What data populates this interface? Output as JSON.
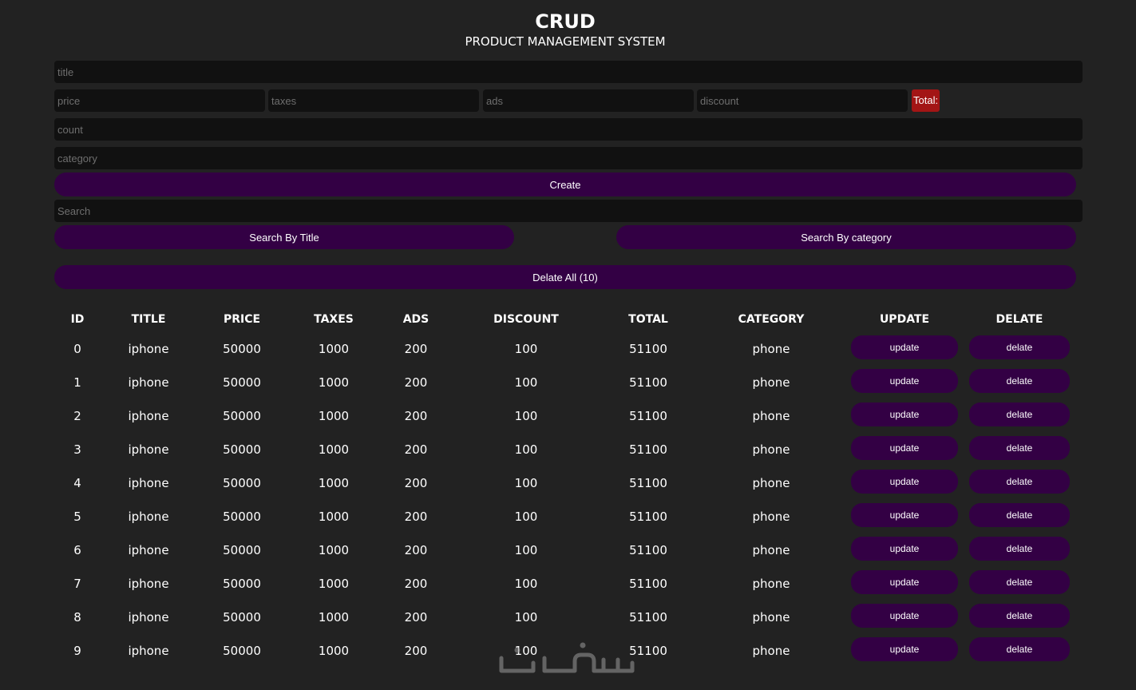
{
  "header": {
    "title": "CRUD",
    "subtitle": "PRODUCT MANAGEMENT SYSTEM"
  },
  "form": {
    "title_placeholder": "title",
    "price_placeholder": "price",
    "taxes_placeholder": "taxes",
    "ads_placeholder": "ads",
    "discount_placeholder": "discount",
    "total_label": "Total:",
    "count_placeholder": "count",
    "category_placeholder": "category",
    "create_label": "Create"
  },
  "search": {
    "placeholder": "Search",
    "by_title_label": "Search By Title",
    "by_category_label": "Search By category"
  },
  "delete_all_label": "Delate All (10)",
  "table": {
    "columns": [
      "ID",
      "TITLE",
      "PRICE",
      "TAXES",
      "ADS",
      "DISCOUNT",
      "TOTAL",
      "CATEGORY",
      "UPDATE",
      "DELATE"
    ],
    "update_label": "update",
    "delete_label": "delate",
    "rows": [
      {
        "id": "0",
        "title": "iphone",
        "price": "50000",
        "taxes": "1000",
        "ads": "200",
        "discount": "100",
        "total": "51100",
        "category": "phone"
      },
      {
        "id": "1",
        "title": "iphone",
        "price": "50000",
        "taxes": "1000",
        "ads": "200",
        "discount": "100",
        "total": "51100",
        "category": "phone"
      },
      {
        "id": "2",
        "title": "iphone",
        "price": "50000",
        "taxes": "1000",
        "ads": "200",
        "discount": "100",
        "total": "51100",
        "category": "phone"
      },
      {
        "id": "3",
        "title": "iphone",
        "price": "50000",
        "taxes": "1000",
        "ads": "200",
        "discount": "100",
        "total": "51100",
        "category": "phone"
      },
      {
        "id": "4",
        "title": "iphone",
        "price": "50000",
        "taxes": "1000",
        "ads": "200",
        "discount": "100",
        "total": "51100",
        "category": "phone"
      },
      {
        "id": "5",
        "title": "iphone",
        "price": "50000",
        "taxes": "1000",
        "ads": "200",
        "discount": "100",
        "total": "51100",
        "category": "phone"
      },
      {
        "id": "6",
        "title": "iphone",
        "price": "50000",
        "taxes": "1000",
        "ads": "200",
        "discount": "100",
        "total": "51100",
        "category": "phone"
      },
      {
        "id": "7",
        "title": "iphone",
        "price": "50000",
        "taxes": "1000",
        "ads": "200",
        "discount": "100",
        "total": "51100",
        "category": "phone"
      },
      {
        "id": "8",
        "title": "iphone",
        "price": "50000",
        "taxes": "1000",
        "ads": "200",
        "discount": "100",
        "total": "51100",
        "category": "phone"
      },
      {
        "id": "9",
        "title": "iphone",
        "price": "50000",
        "taxes": "1000",
        "ads": "200",
        "discount": "100",
        "total": "51100",
        "category": "phone"
      }
    ]
  },
  "watermark": {
    "text": "خمسات",
    "icon": "watermark-logo-icon"
  },
  "colors": {
    "background": "#222222",
    "input_background": "#111111",
    "button": "#330044",
    "total_badge": "#a31515"
  }
}
